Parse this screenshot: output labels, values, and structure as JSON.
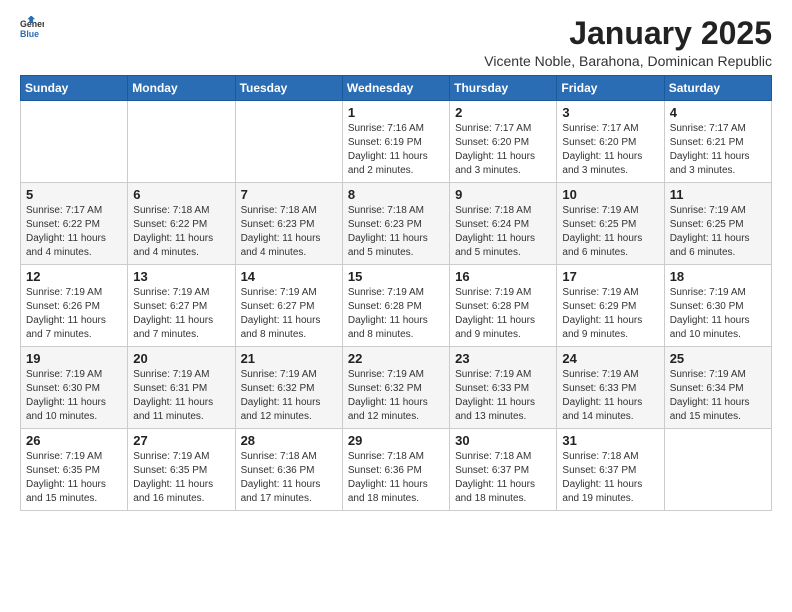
{
  "logo": {
    "general": "General",
    "blue": "Blue"
  },
  "title": "January 2025",
  "subtitle": "Vicente Noble, Barahona, Dominican Republic",
  "days_of_week": [
    "Sunday",
    "Monday",
    "Tuesday",
    "Wednesday",
    "Thursday",
    "Friday",
    "Saturday"
  ],
  "weeks": [
    [
      {
        "day": "",
        "info": ""
      },
      {
        "day": "",
        "info": ""
      },
      {
        "day": "",
        "info": ""
      },
      {
        "day": "1",
        "info": "Sunrise: 7:16 AM\nSunset: 6:19 PM\nDaylight: 11 hours and 2 minutes."
      },
      {
        "day": "2",
        "info": "Sunrise: 7:17 AM\nSunset: 6:20 PM\nDaylight: 11 hours and 3 minutes."
      },
      {
        "day": "3",
        "info": "Sunrise: 7:17 AM\nSunset: 6:20 PM\nDaylight: 11 hours and 3 minutes."
      },
      {
        "day": "4",
        "info": "Sunrise: 7:17 AM\nSunset: 6:21 PM\nDaylight: 11 hours and 3 minutes."
      }
    ],
    [
      {
        "day": "5",
        "info": "Sunrise: 7:17 AM\nSunset: 6:22 PM\nDaylight: 11 hours and 4 minutes."
      },
      {
        "day": "6",
        "info": "Sunrise: 7:18 AM\nSunset: 6:22 PM\nDaylight: 11 hours and 4 minutes."
      },
      {
        "day": "7",
        "info": "Sunrise: 7:18 AM\nSunset: 6:23 PM\nDaylight: 11 hours and 4 minutes."
      },
      {
        "day": "8",
        "info": "Sunrise: 7:18 AM\nSunset: 6:23 PM\nDaylight: 11 hours and 5 minutes."
      },
      {
        "day": "9",
        "info": "Sunrise: 7:18 AM\nSunset: 6:24 PM\nDaylight: 11 hours and 5 minutes."
      },
      {
        "day": "10",
        "info": "Sunrise: 7:19 AM\nSunset: 6:25 PM\nDaylight: 11 hours and 6 minutes."
      },
      {
        "day": "11",
        "info": "Sunrise: 7:19 AM\nSunset: 6:25 PM\nDaylight: 11 hours and 6 minutes."
      }
    ],
    [
      {
        "day": "12",
        "info": "Sunrise: 7:19 AM\nSunset: 6:26 PM\nDaylight: 11 hours and 7 minutes."
      },
      {
        "day": "13",
        "info": "Sunrise: 7:19 AM\nSunset: 6:27 PM\nDaylight: 11 hours and 7 minutes."
      },
      {
        "day": "14",
        "info": "Sunrise: 7:19 AM\nSunset: 6:27 PM\nDaylight: 11 hours and 8 minutes."
      },
      {
        "day": "15",
        "info": "Sunrise: 7:19 AM\nSunset: 6:28 PM\nDaylight: 11 hours and 8 minutes."
      },
      {
        "day": "16",
        "info": "Sunrise: 7:19 AM\nSunset: 6:28 PM\nDaylight: 11 hours and 9 minutes."
      },
      {
        "day": "17",
        "info": "Sunrise: 7:19 AM\nSunset: 6:29 PM\nDaylight: 11 hours and 9 minutes."
      },
      {
        "day": "18",
        "info": "Sunrise: 7:19 AM\nSunset: 6:30 PM\nDaylight: 11 hours and 10 minutes."
      }
    ],
    [
      {
        "day": "19",
        "info": "Sunrise: 7:19 AM\nSunset: 6:30 PM\nDaylight: 11 hours and 10 minutes."
      },
      {
        "day": "20",
        "info": "Sunrise: 7:19 AM\nSunset: 6:31 PM\nDaylight: 11 hours and 11 minutes."
      },
      {
        "day": "21",
        "info": "Sunrise: 7:19 AM\nSunset: 6:32 PM\nDaylight: 11 hours and 12 minutes."
      },
      {
        "day": "22",
        "info": "Sunrise: 7:19 AM\nSunset: 6:32 PM\nDaylight: 11 hours and 12 minutes."
      },
      {
        "day": "23",
        "info": "Sunrise: 7:19 AM\nSunset: 6:33 PM\nDaylight: 11 hours and 13 minutes."
      },
      {
        "day": "24",
        "info": "Sunrise: 7:19 AM\nSunset: 6:33 PM\nDaylight: 11 hours and 14 minutes."
      },
      {
        "day": "25",
        "info": "Sunrise: 7:19 AM\nSunset: 6:34 PM\nDaylight: 11 hours and 15 minutes."
      }
    ],
    [
      {
        "day": "26",
        "info": "Sunrise: 7:19 AM\nSunset: 6:35 PM\nDaylight: 11 hours and 15 minutes."
      },
      {
        "day": "27",
        "info": "Sunrise: 7:19 AM\nSunset: 6:35 PM\nDaylight: 11 hours and 16 minutes."
      },
      {
        "day": "28",
        "info": "Sunrise: 7:18 AM\nSunset: 6:36 PM\nDaylight: 11 hours and 17 minutes."
      },
      {
        "day": "29",
        "info": "Sunrise: 7:18 AM\nSunset: 6:36 PM\nDaylight: 11 hours and 18 minutes."
      },
      {
        "day": "30",
        "info": "Sunrise: 7:18 AM\nSunset: 6:37 PM\nDaylight: 11 hours and 18 minutes."
      },
      {
        "day": "31",
        "info": "Sunrise: 7:18 AM\nSunset: 6:37 PM\nDaylight: 11 hours and 19 minutes."
      },
      {
        "day": "",
        "info": ""
      }
    ]
  ]
}
